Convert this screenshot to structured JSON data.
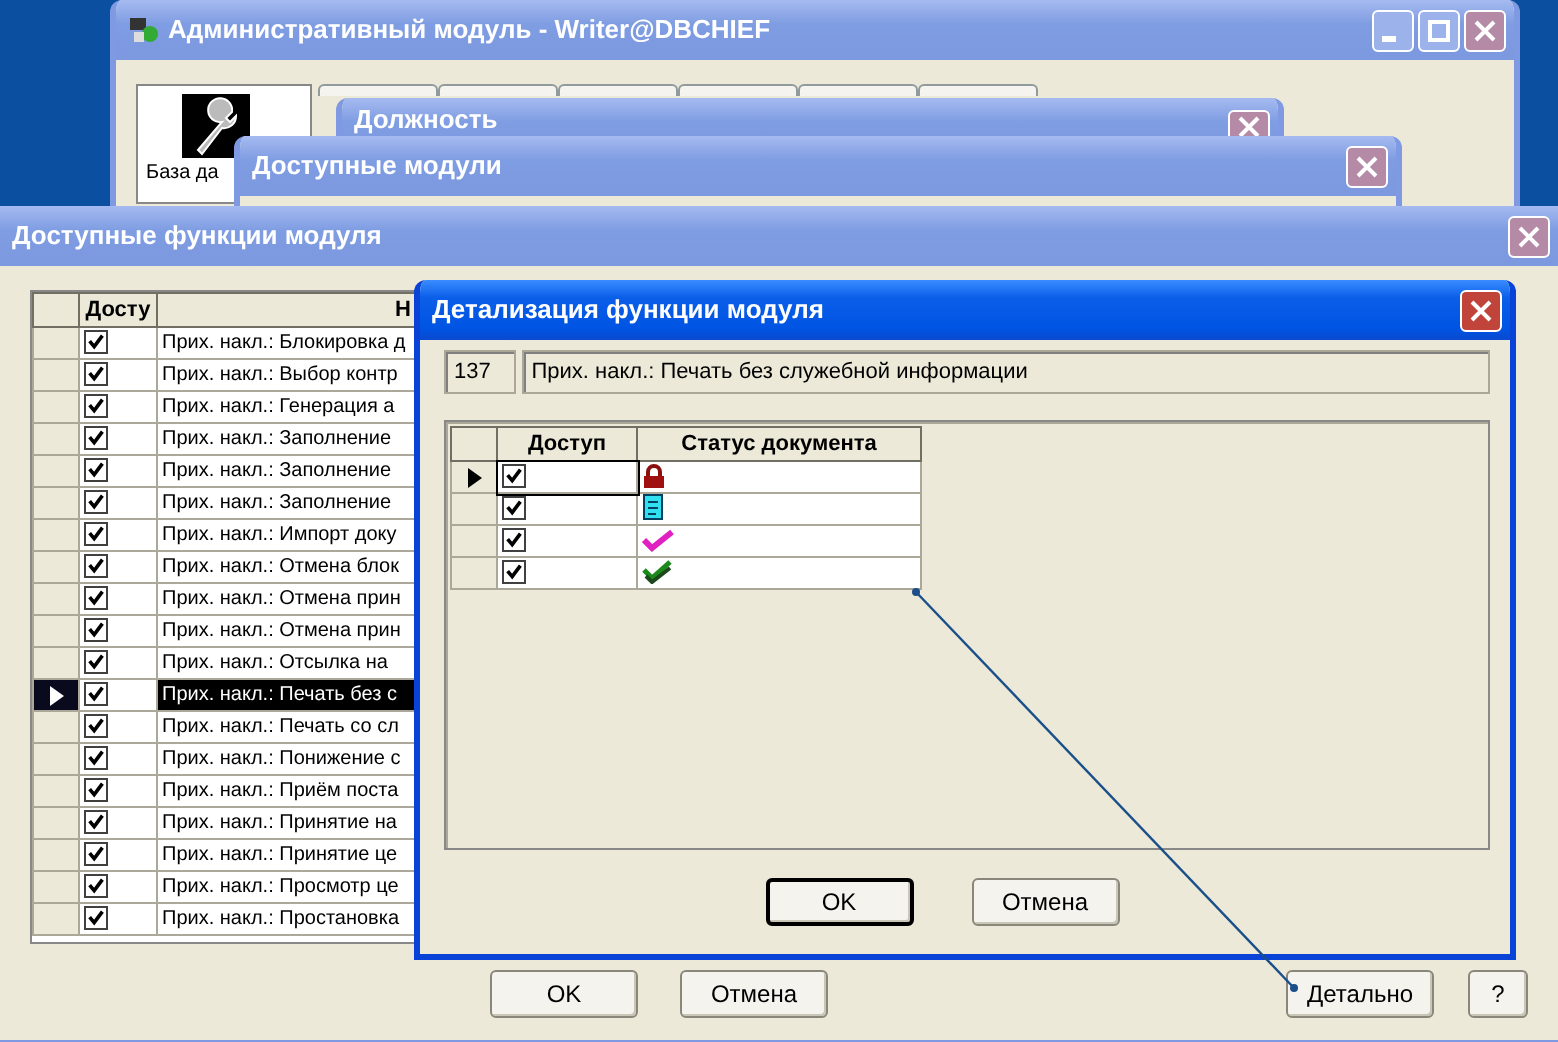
{
  "main_window": {
    "title": "Административный модуль - Writer@DBCHIEF",
    "panel_label": "База да"
  },
  "position_window": {
    "title": "Должность"
  },
  "modules_window": {
    "title": "Доступные модули"
  },
  "functions_window": {
    "title": "Доступные функции модуля",
    "table": {
      "columns": [
        "Досту",
        "Н"
      ],
      "rows": [
        {
          "access": true,
          "name": "Прих. накл.: Блокировка д",
          "selected": false
        },
        {
          "access": true,
          "name": "Прих. накл.: Выбор контр",
          "selected": false
        },
        {
          "access": true,
          "name": "Прих. накл.: Генерация а",
          "selected": false
        },
        {
          "access": true,
          "name": "Прих. накл.: Заполнение",
          "selected": false
        },
        {
          "access": true,
          "name": "Прих. накл.: Заполнение",
          "selected": false
        },
        {
          "access": true,
          "name": "Прих. накл.: Заполнение",
          "selected": false
        },
        {
          "access": true,
          "name": "Прих. накл.: Импорт доку",
          "selected": false
        },
        {
          "access": true,
          "name": "Прих. накл.: Отмена блок",
          "selected": false
        },
        {
          "access": true,
          "name": "Прих. накл.: Отмена прин",
          "selected": false
        },
        {
          "access": true,
          "name": "Прих. накл.: Отмена прин",
          "selected": false
        },
        {
          "access": true,
          "name": "Прих. накл.: Отсылка на",
          "selected": false
        },
        {
          "access": true,
          "name": "Прих. накл.: Печать без с",
          "selected": true
        },
        {
          "access": true,
          "name": "Прих. накл.: Печать со сл",
          "selected": false
        },
        {
          "access": true,
          "name": "Прих. накл.: Понижение с",
          "selected": false
        },
        {
          "access": true,
          "name": "Прих. накл.: Приём поста",
          "selected": false
        },
        {
          "access": true,
          "name": "Прих. накл.: Принятие на",
          "selected": false
        },
        {
          "access": true,
          "name": "Прих. накл.: Принятие це",
          "selected": false
        },
        {
          "access": true,
          "name": "Прих. накл.: Просмотр це",
          "selected": false
        },
        {
          "access": true,
          "name": "Прих. накл.: Простановка",
          "selected": false
        }
      ]
    },
    "buttons": [
      "OK",
      "Отмена",
      "Детально",
      "?"
    ]
  },
  "detail_dialog": {
    "title": "Детализация функции модуля",
    "id": "137",
    "function_name": "Прих. накл.: Печать без служебной информации",
    "table": {
      "columns": [
        "Доступ",
        "Статус документа"
      ],
      "rows": [
        {
          "access": true,
          "kind": "lock",
          "selected": true
        },
        {
          "access": true,
          "kind": "document",
          "selected": false
        },
        {
          "access": true,
          "kind": "check",
          "selected": false
        },
        {
          "access": true,
          "kind": "double-check",
          "selected": false
        }
      ]
    },
    "buttons": [
      "OK",
      "Отмена"
    ]
  }
}
